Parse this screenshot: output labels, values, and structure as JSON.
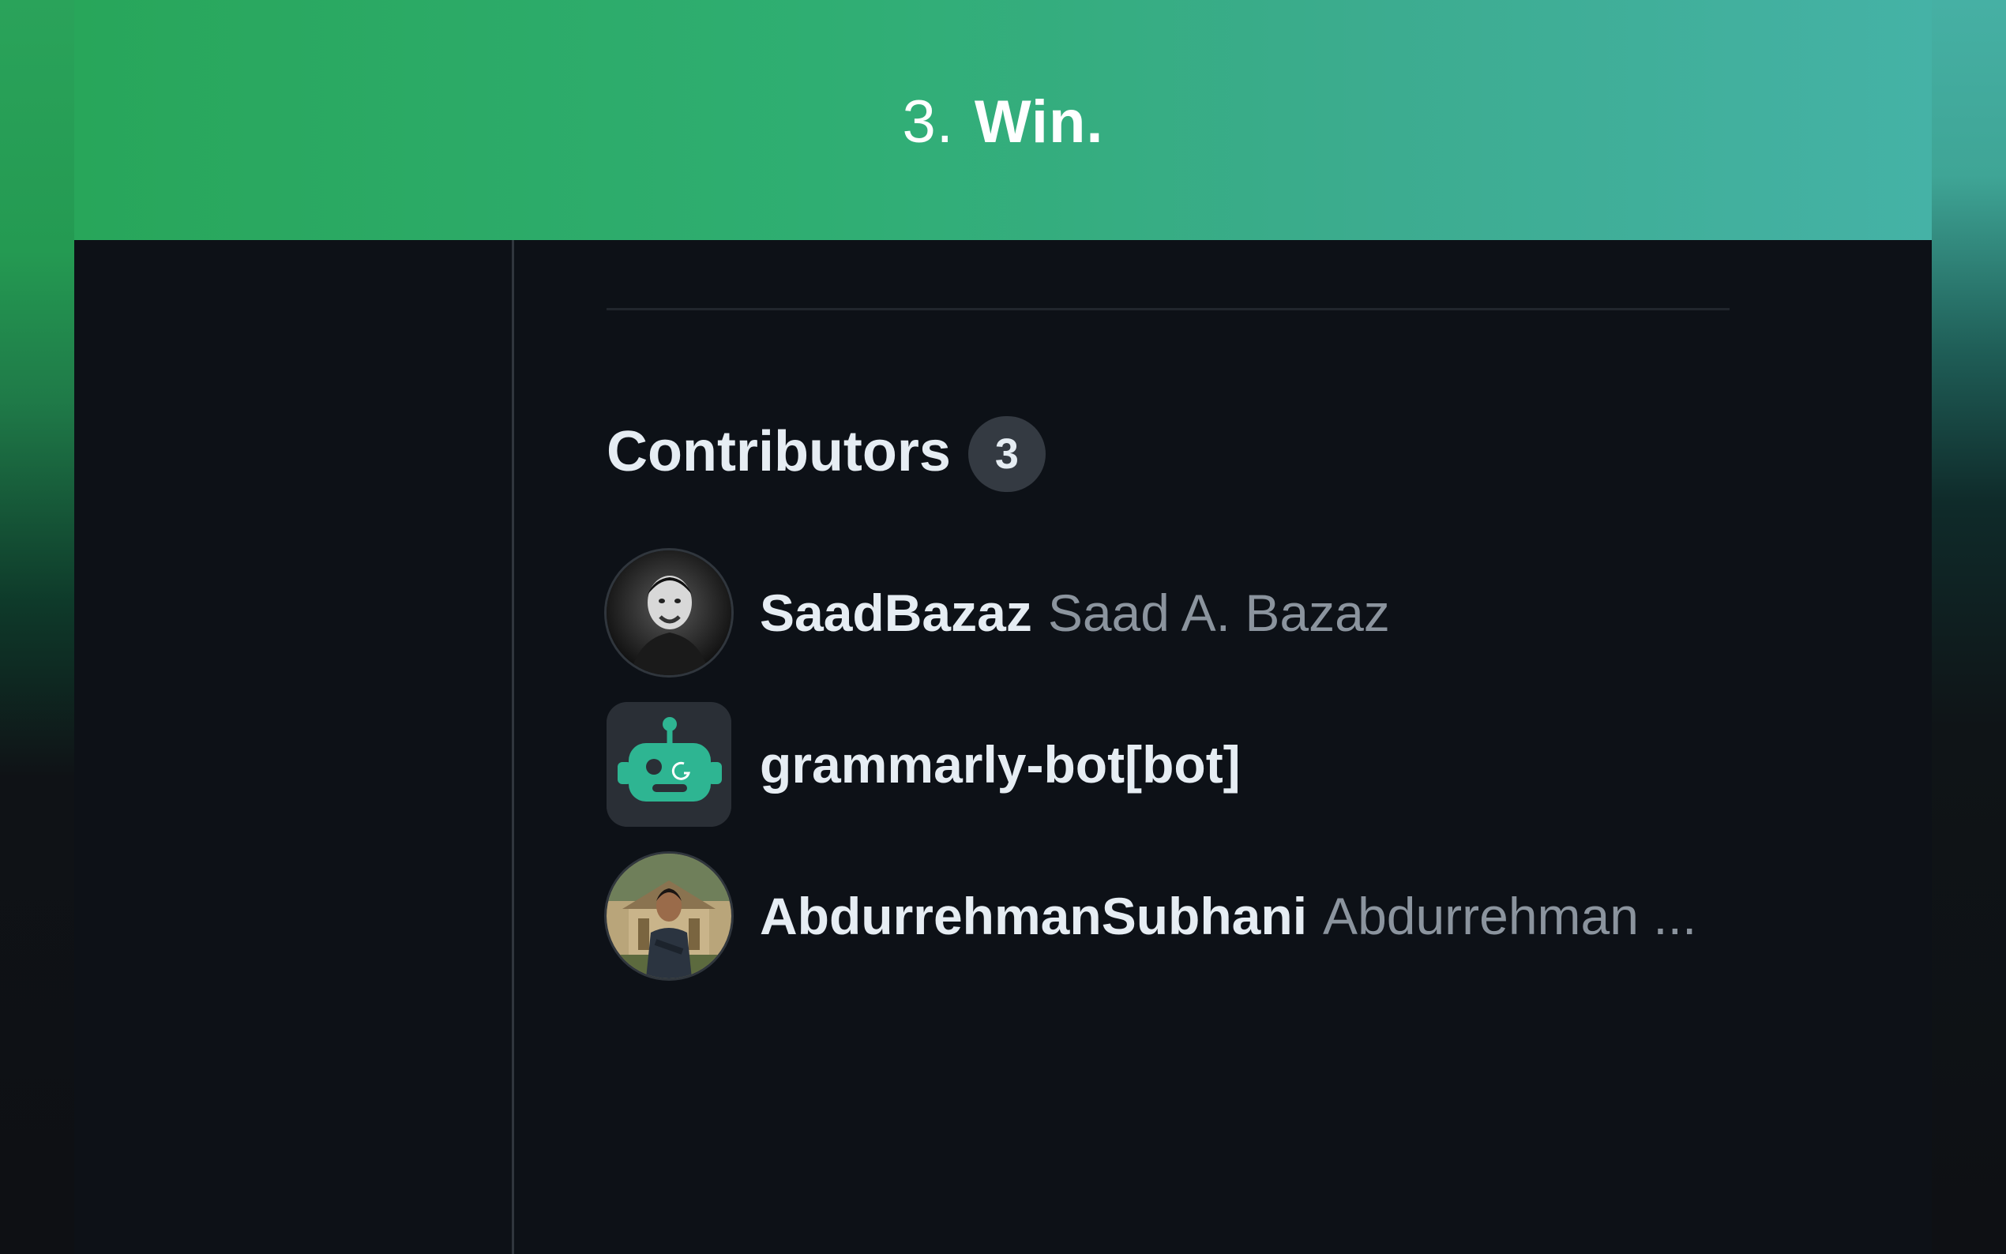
{
  "banner": {
    "number": "3.",
    "word": "Win."
  },
  "contributors": {
    "title": "Contributors",
    "count": "3",
    "items": [
      {
        "login": "SaadBazaz",
        "name": "Saad A. Bazaz",
        "avatar": "photo-avatar"
      },
      {
        "login": "grammarly-bot[bot]",
        "name": "",
        "avatar": "bot-icon"
      },
      {
        "login": "AbdurrehmanSubhani",
        "name": "Abdurrehman ...",
        "avatar": "photo-avatar"
      }
    ]
  },
  "colors": {
    "banner_start": "#28a65a",
    "banner_end": "#45b2a6",
    "page_bg": "#0d1117",
    "text_primary": "#e6edf3",
    "text_muted": "#8b949e",
    "bot_green": "#2eb592"
  }
}
